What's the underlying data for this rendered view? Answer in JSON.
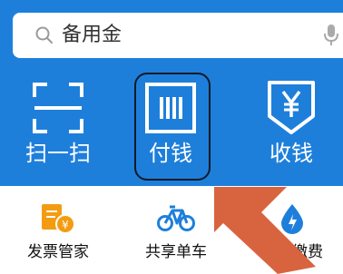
{
  "search": {
    "placeholder": "备用金"
  },
  "actions": [
    {
      "label": "扫一扫",
      "icon": "scan-icon"
    },
    {
      "label": "付钱",
      "icon": "barcode-pay-icon"
    },
    {
      "label": "收钱",
      "icon": "yen-receive-icon"
    }
  ],
  "services": [
    {
      "label": "发票管家",
      "icon": "invoice-icon",
      "color": "#f39c12"
    },
    {
      "label": "共享单车",
      "icon": "bicycle-icon",
      "color": "#1e7fdb"
    },
    {
      "label": "生活缴费",
      "icon": "water-drop-icon",
      "color": "#1e7fdb"
    }
  ],
  "colors": {
    "primary": "#1e7fdb",
    "arrow": "#d8643f",
    "highlight_outline": "#0e1a24"
  }
}
